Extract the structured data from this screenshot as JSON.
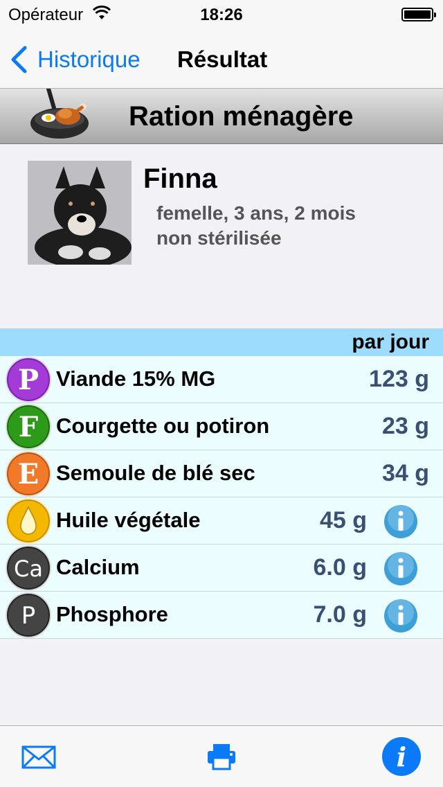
{
  "status_bar": {
    "carrier": "Opérateur",
    "time": "18:26",
    "battery_level": 1.0
  },
  "nav": {
    "back_label": "Historique",
    "title": "Résultat"
  },
  "ration": {
    "title": "Ration ménagère"
  },
  "dog": {
    "name": "Finna",
    "details_line1": "femelle, 3 ans, 2 mois",
    "details_line2": "non stérilisée"
  },
  "table": {
    "header": "par jour",
    "rows": [
      {
        "icon": "P",
        "icon_name": "protein-icon",
        "color": "#a43bd8",
        "label": "Viande 15% MG",
        "value": "123 g",
        "info": false
      },
      {
        "icon": "F",
        "icon_name": "fiber-icon",
        "color": "#2e9a1a",
        "label": "Courgette ou potiron",
        "value": "23 g",
        "info": false
      },
      {
        "icon": "E",
        "icon_name": "energy-icon",
        "color": "#f07a2a",
        "label": "Semoule de blé sec",
        "value": "34 g",
        "info": false
      },
      {
        "icon": "drop",
        "icon_name": "oil-drop-icon",
        "color": "#f5b800",
        "label": "Huile végétale",
        "value": "45 g",
        "info": true
      },
      {
        "icon": "Ca",
        "icon_name": "calcium-icon",
        "color": "#444444",
        "label": "Calcium",
        "value": "6.0 g",
        "info": true
      },
      {
        "icon": "P",
        "icon_name": "phosphorus-icon",
        "color": "#444444",
        "label": "Phosphore",
        "value": "7.0 g",
        "info": true
      }
    ]
  },
  "colors": {
    "accent": "#0a7af6",
    "table_header_bg": "#9edcfe",
    "row_bg": "#ebfdfe",
    "value_text": "#3a4f75"
  }
}
